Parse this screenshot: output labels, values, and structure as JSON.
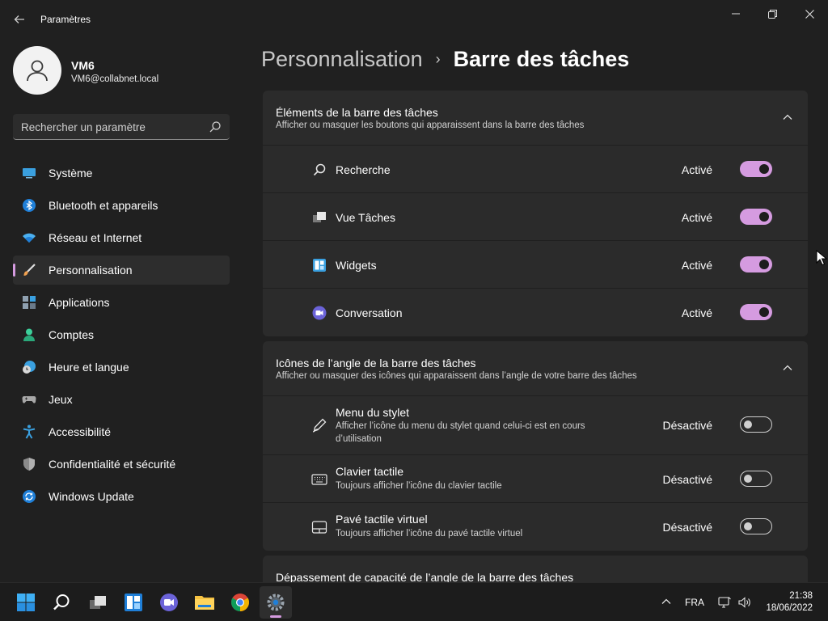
{
  "window": {
    "title": "Paramètres",
    "back_icon": "back-arrow-icon",
    "controls": [
      "minimize",
      "restore",
      "close"
    ]
  },
  "profile": {
    "name": "VM6",
    "email": "VM6@collabnet.local"
  },
  "search": {
    "placeholder": "Rechercher un paramètre"
  },
  "sidebar": {
    "items": [
      {
        "label": "Système",
        "icon": "system-icon"
      },
      {
        "label": "Bluetooth et appareils",
        "icon": "bluetooth-icon"
      },
      {
        "label": "Réseau et Internet",
        "icon": "wifi-icon"
      },
      {
        "label": "Personnalisation",
        "icon": "brush-icon",
        "active": true
      },
      {
        "label": "Applications",
        "icon": "apps-icon"
      },
      {
        "label": "Comptes",
        "icon": "person-icon"
      },
      {
        "label": "Heure et langue",
        "icon": "clock-globe-icon"
      },
      {
        "label": "Jeux",
        "icon": "gamepad-icon"
      },
      {
        "label": "Accessibilité",
        "icon": "accessibility-icon"
      },
      {
        "label": "Confidentialité et sécurité",
        "icon": "shield-icon"
      },
      {
        "label": "Windows Update",
        "icon": "update-icon"
      }
    ]
  },
  "breadcrumb": {
    "parent": "Personnalisation",
    "separator": "›",
    "current": "Barre des tâches"
  },
  "sections": {
    "items": {
      "title": "Éléments de la barre des tâches",
      "subtitle": "Afficher ou masquer les boutons qui apparaissent dans la barre des tâches",
      "rows": [
        {
          "label": "Recherche",
          "state": "Activé",
          "on": true,
          "icon": "search-icon"
        },
        {
          "label": "Vue Tâches",
          "state": "Activé",
          "on": true,
          "icon": "task-view-icon"
        },
        {
          "label": "Widgets",
          "state": "Activé",
          "on": true,
          "icon": "widgets-icon"
        },
        {
          "label": "Conversation",
          "state": "Activé",
          "on": true,
          "icon": "chat-icon"
        }
      ]
    },
    "corner_icons": {
      "title": "Icônes de l’angle de la barre des tâches",
      "subtitle": "Afficher ou masquer des icônes qui apparaissent dans l’angle de votre barre des tâches",
      "rows": [
        {
          "label": "Menu du stylet",
          "desc": "Afficher l’icône du menu du stylet quand celui-ci est en cours d’utilisation",
          "state": "Désactivé",
          "on": false,
          "icon": "pen-icon"
        },
        {
          "label": "Clavier tactile",
          "desc": "Toujours afficher l’icône du clavier tactile",
          "state": "Désactivé",
          "on": false,
          "icon": "keyboard-icon"
        },
        {
          "label": "Pavé tactile virtuel",
          "desc": "Toujours afficher l’icône du pavé tactile virtuel",
          "state": "Désactivé",
          "on": false,
          "icon": "touchpad-icon"
        }
      ]
    },
    "overflow": {
      "title": "Dépassement de capacité de l’angle de la barre des tâches"
    }
  },
  "taskbar": {
    "apps": [
      "start-icon",
      "search-icon",
      "task-view-icon",
      "widgets-icon",
      "chat-icon",
      "file-explorer-icon",
      "chrome-icon",
      "settings-icon"
    ],
    "tray": {
      "language": "FRA",
      "time": "21:38",
      "date": "18/06/2022"
    }
  },
  "colors": {
    "accent": "#d59be0",
    "background": "#202020",
    "card": "#2b2b2b"
  }
}
